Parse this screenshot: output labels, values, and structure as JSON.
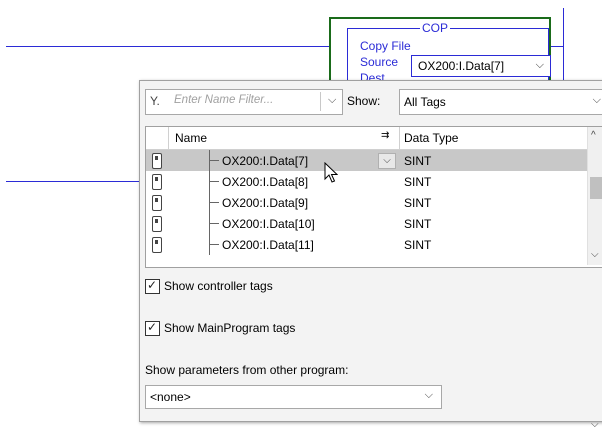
{
  "ladder": {
    "instruction": "COP",
    "copy_file_label": "Copy File",
    "source_label": "Source",
    "dest_label": "Dest",
    "source_value": "OX200:I.Data[7]",
    "source_chevron": "⌵"
  },
  "browser": {
    "filter_icon": "Y.",
    "filter_placeholder": "Enter Name Filter...",
    "filter_chevron": "⌵",
    "show_label": "Show:",
    "show_value": "All Tags",
    "show_chevron": "⌵",
    "columns": {
      "name": "Name",
      "sort_icon": "⇉",
      "data_type": "Data Type"
    },
    "rows": [
      {
        "name": "OX200:I.Data[7]",
        "data_type": "SINT",
        "selected": true
      },
      {
        "name": "OX200:I.Data[8]",
        "data_type": "SINT",
        "selected": false
      },
      {
        "name": "OX200:I.Data[9]",
        "data_type": "SINT",
        "selected": false
      },
      {
        "name": "OX200:I.Data[10]",
        "data_type": "SINT",
        "selected": false
      },
      {
        "name": "OX200:I.Data[11]",
        "data_type": "SINT",
        "selected": false
      }
    ],
    "row_chevron": "⌵",
    "scroll_up": "^",
    "scroll_down": "⌵",
    "show_controller_tags": "Show controller tags",
    "show_mainprogram_tags": "Show MainProgram tags",
    "show_params_label": "Show parameters from other program:",
    "program_value": "<none>",
    "program_chevron": "⌵"
  },
  "colors": {
    "rung": "#2b2bd6",
    "cop_border": "#1a6b1a",
    "selection": "#c8c8c8"
  }
}
